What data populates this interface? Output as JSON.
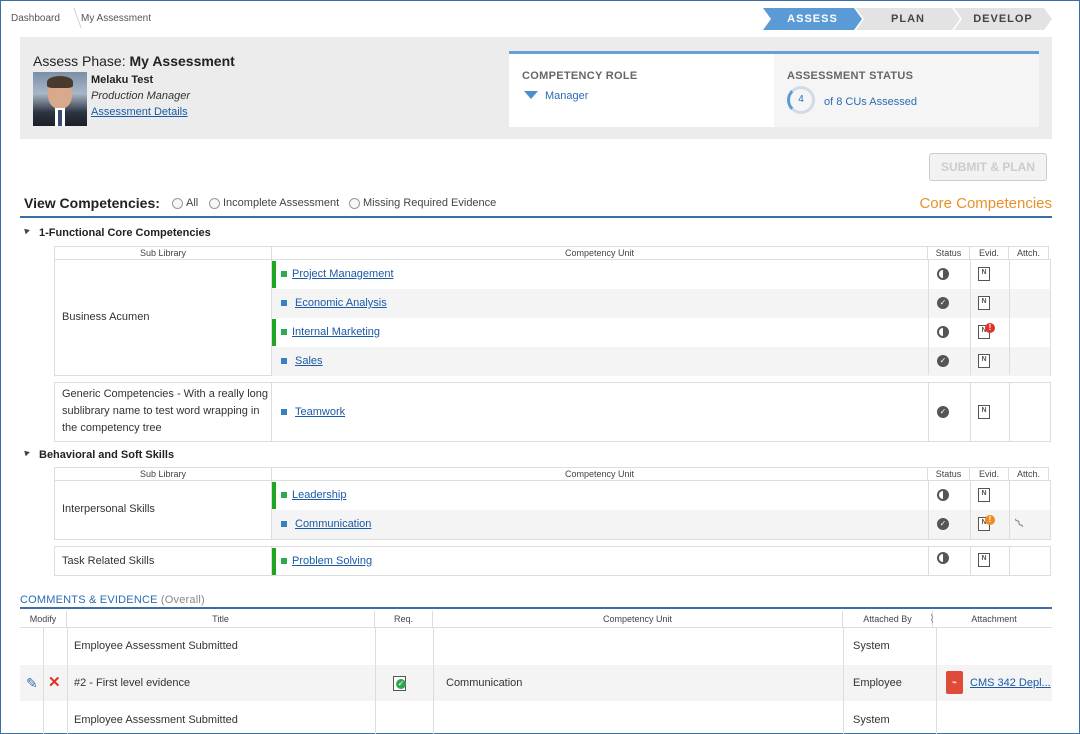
{
  "breadcrumb": {
    "home": "Dashboard",
    "current": "My Assessment"
  },
  "phases": [
    "ASSESS",
    "PLAN",
    "DEVELOP"
  ],
  "header": {
    "title_prefix": "Assess Phase:",
    "title_name": "My Assessment",
    "person_name": "Melaku Test",
    "person_role": "Production Manager",
    "details_link": "Assessment Details"
  },
  "role_card": {
    "label": "COMPETENCY ROLE",
    "value": "Manager"
  },
  "status_card": {
    "label": "ASSESSMENT STATUS",
    "assessed": "4",
    "text": "of 8 CUs Assessed"
  },
  "submit_label": "SUBMIT & PLAN",
  "view": {
    "title": "View Competencies:",
    "options": [
      "All",
      "Incomplete Assessment",
      "Missing Required Evidence"
    ],
    "section_label": "Core Competencies"
  },
  "columns": {
    "sub": "Sub Library",
    "unit": "Competency Unit",
    "status": "Status",
    "evid": "Evid.",
    "attch": "Attch."
  },
  "groups": [
    {
      "title": "1-Functional Core Competencies",
      "libraries": [
        {
          "name": "Business Acumen",
          "units": [
            {
              "name": "Project Management",
              "required": true,
              "status": "partial",
              "evidence": "none"
            },
            {
              "name": "Economic Analysis",
              "required": false,
              "status": "complete",
              "evidence": "none"
            },
            {
              "name": "Internal Marketing",
              "required": true,
              "status": "partial",
              "evidence": "missing"
            },
            {
              "name": "Sales",
              "required": false,
              "status": "complete",
              "evidence": "none"
            }
          ]
        },
        {
          "name": "Generic Competencies - With a really long sublibrary name to test word wrapping in the competency tree",
          "units": [
            {
              "name": "Teamwork",
              "required": false,
              "status": "complete",
              "evidence": "none"
            }
          ]
        }
      ]
    },
    {
      "title": "Behavioral and Soft Skills",
      "libraries": [
        {
          "name": "Interpersonal Skills",
          "units": [
            {
              "name": "Leadership",
              "required": true,
              "status": "partial",
              "evidence": "none"
            },
            {
              "name": "Communication",
              "required": false,
              "status": "complete",
              "evidence": "pending",
              "attachment": true
            }
          ]
        },
        {
          "name": "Task Related Skills",
          "units": [
            {
              "name": "Problem Solving",
              "required": true,
              "status": "partial",
              "evidence": "none"
            }
          ]
        }
      ]
    }
  ],
  "comments": {
    "title": "COMMENTS & EVIDENCE",
    "subtitle": "(Overall)",
    "columns": {
      "modify": "Modify",
      "title": "Title",
      "req": "Req.",
      "unit": "Competency Unit",
      "by": "Attached By",
      "attachment": "Attachment"
    },
    "rows": [
      {
        "title": "Employee Assessment Submitted",
        "unit": "",
        "by": "System",
        "attachment": ""
      },
      {
        "title": "#2 - First level evidence",
        "unit": "Communication",
        "by": "Employee",
        "attachment": "CMS 342 Depl..."
      },
      {
        "title": "Employee Assessment Submitted",
        "unit": "",
        "by": "System",
        "attachment": ""
      }
    ]
  },
  "colors": {
    "accent": "#5b9bd5",
    "required_bar": "#1fa51f",
    "core": "#e8912a",
    "link": "#1a5aa6"
  }
}
